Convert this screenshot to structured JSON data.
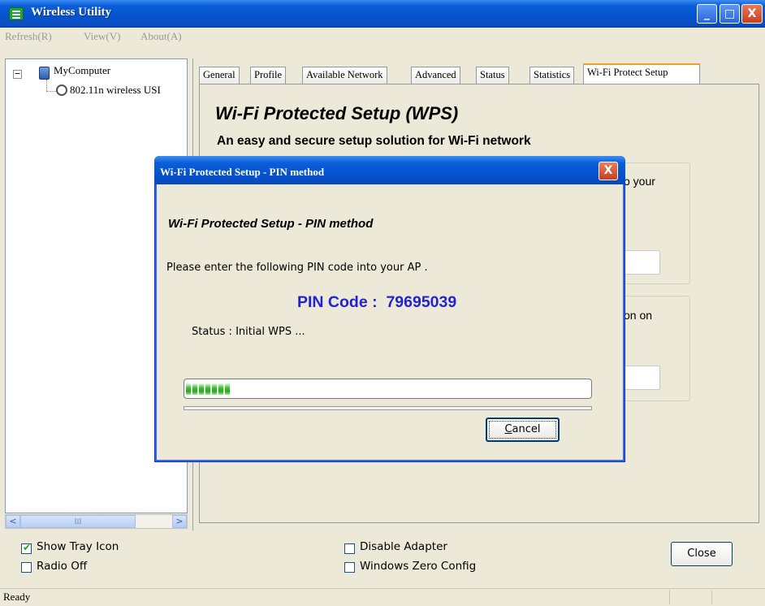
{
  "window": {
    "title": "Wireless Utility",
    "minimize": "_",
    "maximize": "□",
    "close": "X"
  },
  "menu": {
    "refresh": "Refresh(R)",
    "view": "View(V)",
    "about": "About(A)"
  },
  "tree": {
    "expander": "−",
    "root": "MyComputer",
    "child": "802.11n wireless USI",
    "scroll_left": "<",
    "scroll_right": ">",
    "scroll_grip": "III"
  },
  "tabs": [
    {
      "label": "General"
    },
    {
      "label": "Profile"
    },
    {
      "label": "Available Network"
    },
    {
      "label": "Advanced"
    },
    {
      "label": "Status"
    },
    {
      "label": "Statistics"
    },
    {
      "label": "Wi-Fi Protect Setup",
      "active": true
    }
  ],
  "wps": {
    "heading": "Wi-Fi Protected Setup (WPS)",
    "subheading": "An easy and secure setup solution for Wi-Fi network",
    "partial_text_1": "o your",
    "partial_text_2": "on on"
  },
  "bottom": {
    "show_tray_icon": {
      "label": "Show Tray Icon",
      "checked": true
    },
    "radio_off": {
      "label": "Radio Off",
      "checked": false
    },
    "disable_adapter": {
      "label": "Disable Adapter",
      "checked": false
    },
    "windows_zero_config": {
      "label": "Windows Zero Config",
      "checked": false
    },
    "close_label": "Close",
    "check_glyph": "✔"
  },
  "status_bar": {
    "text": "Ready"
  },
  "dialog": {
    "title": "Wi-Fi Protected Setup - PIN method",
    "close": "X",
    "heading": "Wi-Fi Protected Setup - PIN method",
    "instruction": "Please enter the following PIN code into your AP .",
    "pin_label": "PIN Code :",
    "pin_code": "79695039",
    "status_text": "Status : Initial WPS ...",
    "progress_percent": 15,
    "cancel_label": "Cancel"
  },
  "colors": {
    "pin": "#2323D2",
    "titlebar": "#0552CE",
    "progress": "#24A81B"
  }
}
